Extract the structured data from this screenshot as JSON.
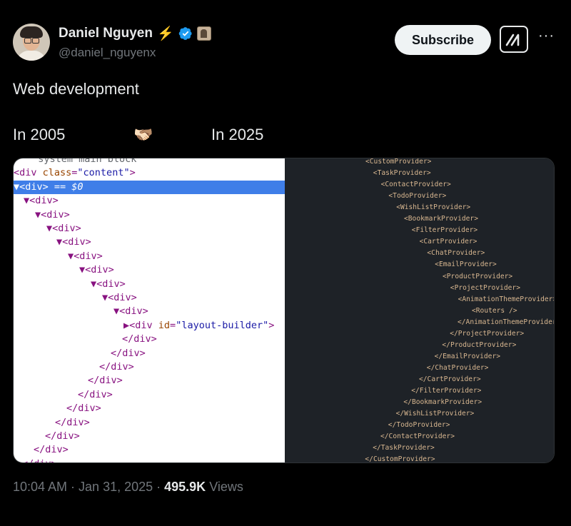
{
  "author": {
    "display_name": "Daniel Nguyen",
    "bolt_emoji": "⚡",
    "handle": "@daniel_nguyenx"
  },
  "actions": {
    "subscribe_label": "Subscribe",
    "more_label": "···"
  },
  "tweet": {
    "text": "Web development",
    "label_left": "In 2005",
    "handshake": "🫱🏻‍🫲🏽",
    "label_right": "In 2025"
  },
  "devtools": {
    "lines": [
      {
        "raw": "  system main block"
      },
      {
        "tag_open": "<div ",
        "attr": "class",
        "eq": "=",
        "val": "\"content\"",
        "tag_close": ">"
      },
      {
        "selected": "▼<div> == $0"
      },
      {
        "raw": "▼<div>"
      },
      {
        "raw": "▼<div>"
      },
      {
        "raw": "▼<div>"
      },
      {
        "raw": "▼<div>"
      },
      {
        "raw": "▼<div>"
      },
      {
        "raw": "▼<div>"
      },
      {
        "raw": "▼<div>"
      },
      {
        "raw": "▼<div>"
      },
      {
        "raw": "▼<div>"
      },
      {
        "tag_open": "▶<div ",
        "attr": "id",
        "eq": "=",
        "val": "\"layout-builder\"",
        "tag_close": ">"
      },
      {
        "raw": "</div>"
      },
      {
        "raw": "</div>"
      },
      {
        "raw": "</div>"
      },
      {
        "raw": "</div>"
      },
      {
        "raw": "</div>"
      },
      {
        "raw": "</div>"
      },
      {
        "raw": "</div>"
      },
      {
        "raw": "</div>"
      },
      {
        "raw": "</div>"
      },
      {
        "raw": "</div>"
      }
    ]
  },
  "code_lines": [
    "<CustomProvider>",
    "<TaskProvider>",
    "<ContactProvider>",
    "<TodoProvider>",
    "<WishListProvider>",
    "<BookmarkProvider>",
    "<FilterProvider>",
    "<CartProvider>",
    "<ChatProvider>",
    "<EmailProvider>",
    "<ProductProvider>",
    "<ProjectProvider>",
    "<AnimationThemeProvider>",
    "<Routers />",
    "</AnimationThemeProvider>",
    "</ProjectProvider>",
    "</ProductProvider>",
    "</EmailProvider>",
    "</ChatProvider>",
    "</CartProvider>",
    "</FilterProvider>",
    "</BookmarkProvider>",
    "</WishListProvider>",
    "</TodoProvider>",
    "</ContactProvider>",
    "</TaskProvider>",
    "</CustomProvider>"
  ],
  "meta": {
    "time": "10:04 AM · Jan 31, 2025 · ",
    "views_count": "495.9K",
    "views_label": " Views"
  },
  "colors": {
    "accent_blue": "#1d9bf0",
    "bolt": "#f5b700",
    "code_bg": "#1e2227",
    "code_text": "#d8b790"
  }
}
